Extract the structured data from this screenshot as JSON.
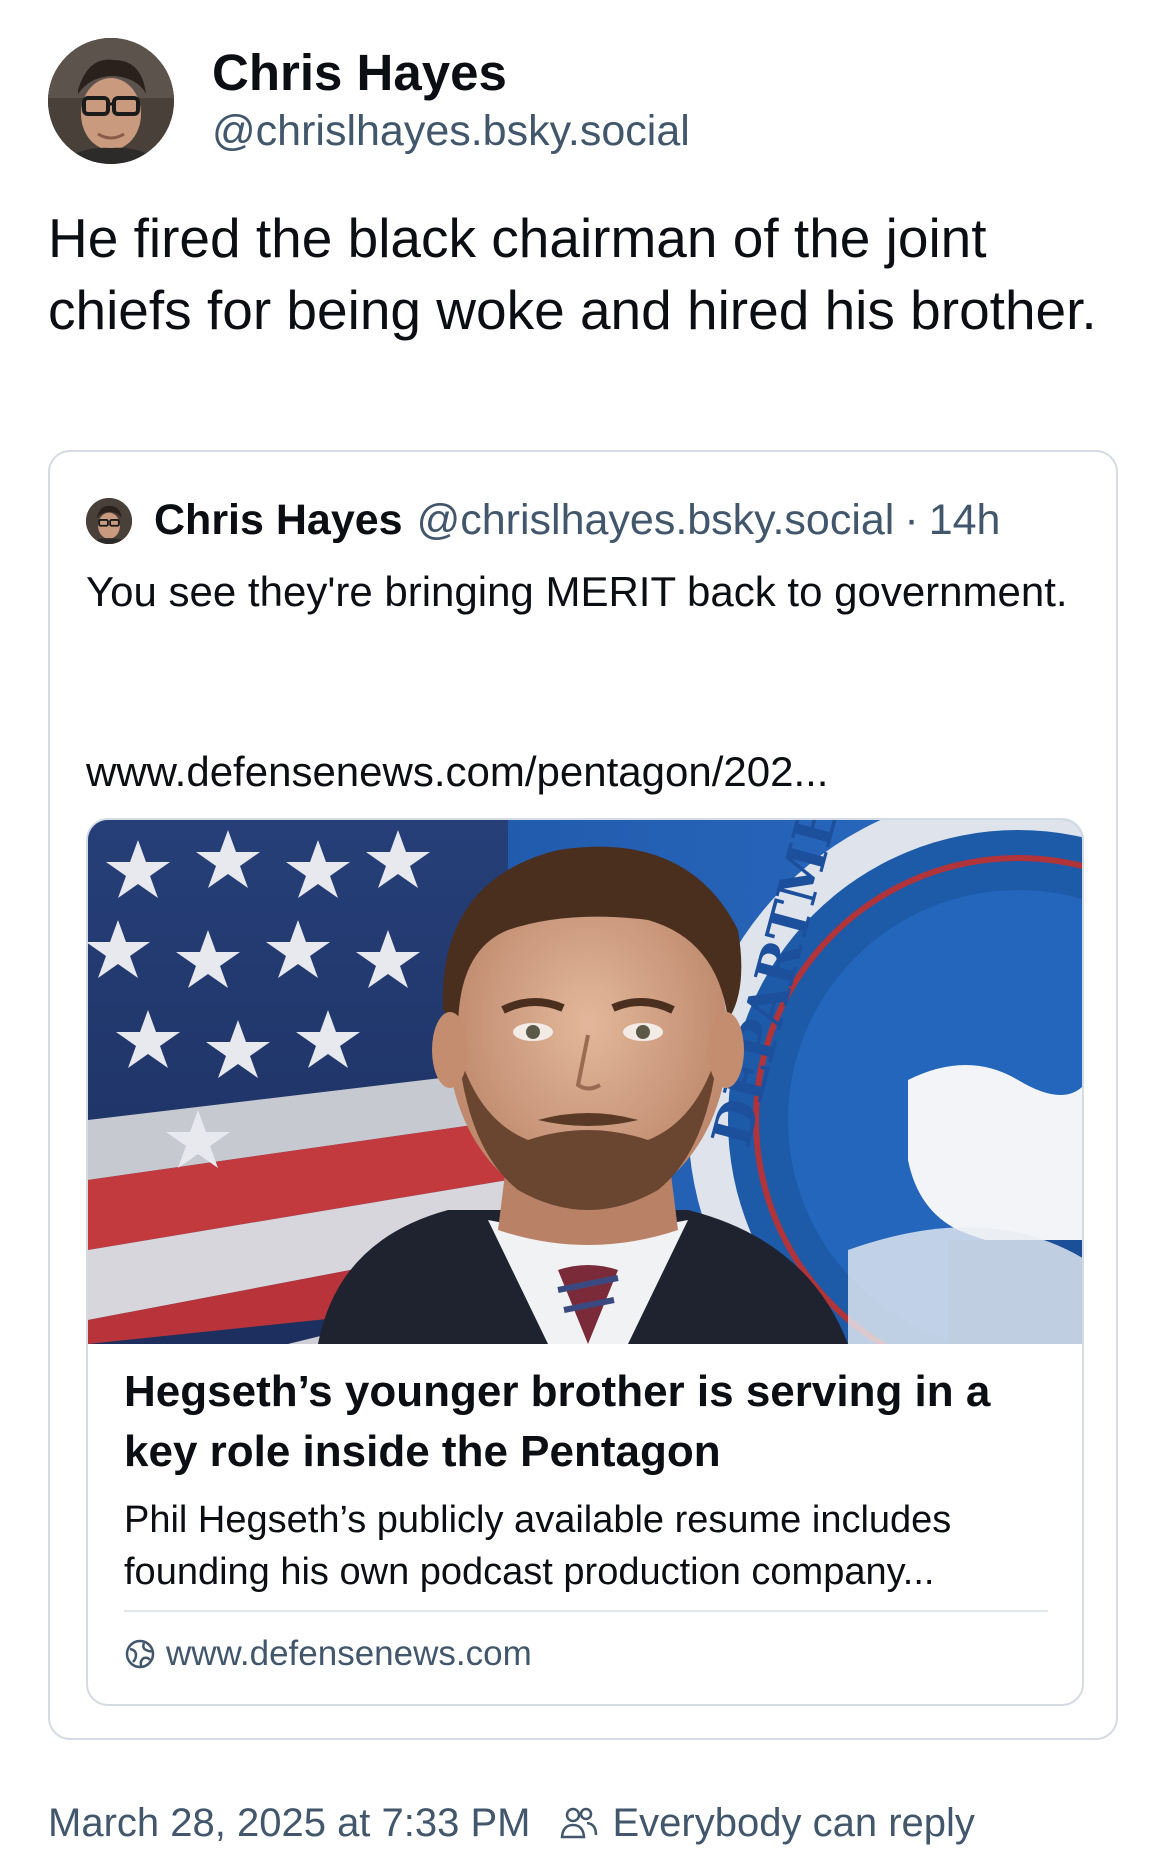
{
  "post": {
    "author": {
      "display_name": "Chris Hayes",
      "handle": "@chrislhayes.bsky.social"
    },
    "text": "He fired the black chairman of the joint chiefs for being woke and hired his brother.",
    "quote": {
      "display_name": "Chris Hayes",
      "handle": "@chrislhayes.bsky.social",
      "separator": "·",
      "time": "14h",
      "text": "You see they're bringing MERIT back to government.",
      "link": "www.defensenews.com/pentagon/202...",
      "embed": {
        "title": "Hegseth’s younger brother is serving in a key role inside the Pentagon",
        "description": "Phil Hegseth’s publicly available resume includes founding his own podcast production company...",
        "domain": "www.defensenews.com",
        "domain_icon": "globe-icon",
        "image_seal_text": "DEPARTMENT"
      }
    },
    "meta": {
      "timestamp": "March 28, 2025 at 7:33 PM",
      "reply_setting": "Everybody can reply",
      "reply_icon": "people-icon"
    }
  },
  "colors": {
    "text_primary": "#0b0f14",
    "text_secondary": "#42576c",
    "border": "#d4dbe2"
  }
}
